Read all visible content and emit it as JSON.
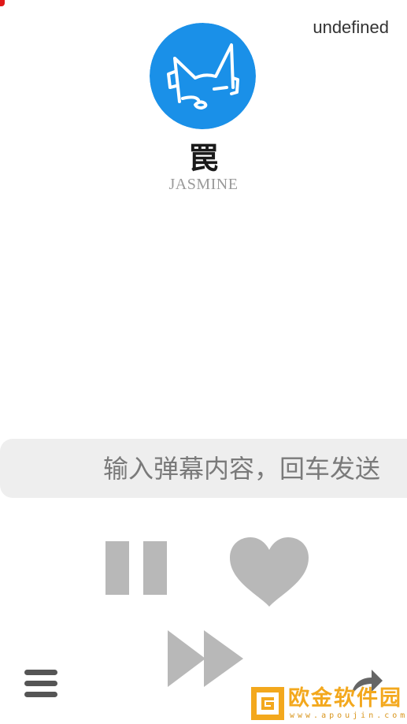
{
  "status": {
    "top_right_text": "undefined"
  },
  "song": {
    "title": "罠",
    "artist": "JASMINE"
  },
  "danmaku": {
    "placeholder": "输入弹幕内容，回车发送",
    "value": ""
  },
  "controls": {
    "pause_icon": "pause-icon",
    "like_icon": "heart-icon",
    "next_icon": "fast-forward-icon",
    "menu_icon": "menu-icon",
    "share_icon": "share-icon",
    "icon_color": "#b8b8b8",
    "menu_color": "#555555"
  },
  "avatar": {
    "background": "#1a90e8",
    "icon": "cat-face-icon"
  },
  "watermark": {
    "title": "欧金软件园",
    "url": "www.apoujin.com",
    "color": "#f3a81d"
  }
}
